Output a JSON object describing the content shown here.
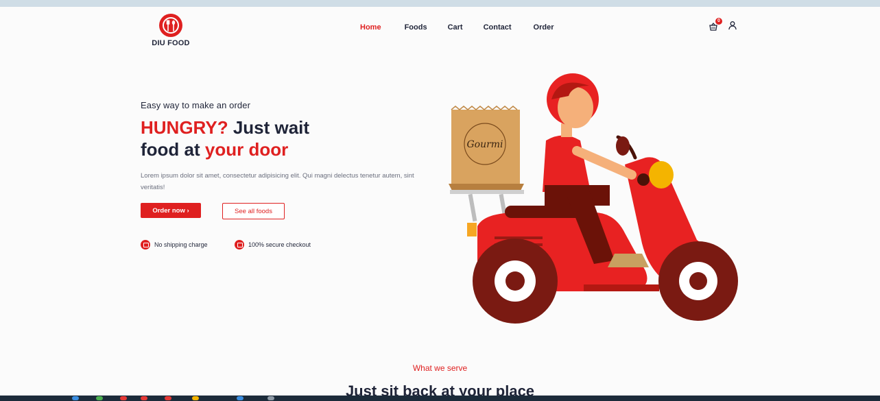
{
  "brand": {
    "name": "DIU FOOD",
    "logo_icon": "fork-spoon-icon"
  },
  "nav": [
    {
      "label": "Home",
      "active": true
    },
    {
      "label": "Foods",
      "active": false
    },
    {
      "label": "Cart",
      "active": false
    },
    {
      "label": "Contact",
      "active": false
    },
    {
      "label": "Order",
      "active": false
    }
  ],
  "header_icons": {
    "cart_icon": "basket-icon",
    "cart_count": "0",
    "user_icon": "user-icon"
  },
  "hero": {
    "subtitle": "Easy way to make an order",
    "headline_part1": "HUNGRY?",
    "headline_part2": " Just wait",
    "headline_part3": "food at ",
    "headline_part4": "your door",
    "description": "Lorem ipsum dolor sit amet, consectetur adipisicing elit. Qui magni delectus tenetur autem, sint veritatis!",
    "primary_button": "Order now ›",
    "secondary_button": "See all foods",
    "features": [
      {
        "label": "No shipping charge",
        "icon": "car-icon"
      },
      {
        "label": "100% secure checkout",
        "icon": "shield-icon"
      }
    ],
    "illustration_bag_text": "Gourmi"
  },
  "section": {
    "eyebrow": "What we serve",
    "title": "Just sit back at your place"
  },
  "colors": {
    "accent": "#df2020",
    "text": "#1f2438",
    "scooter": "#e82222",
    "wheel": "#7a1a12"
  }
}
